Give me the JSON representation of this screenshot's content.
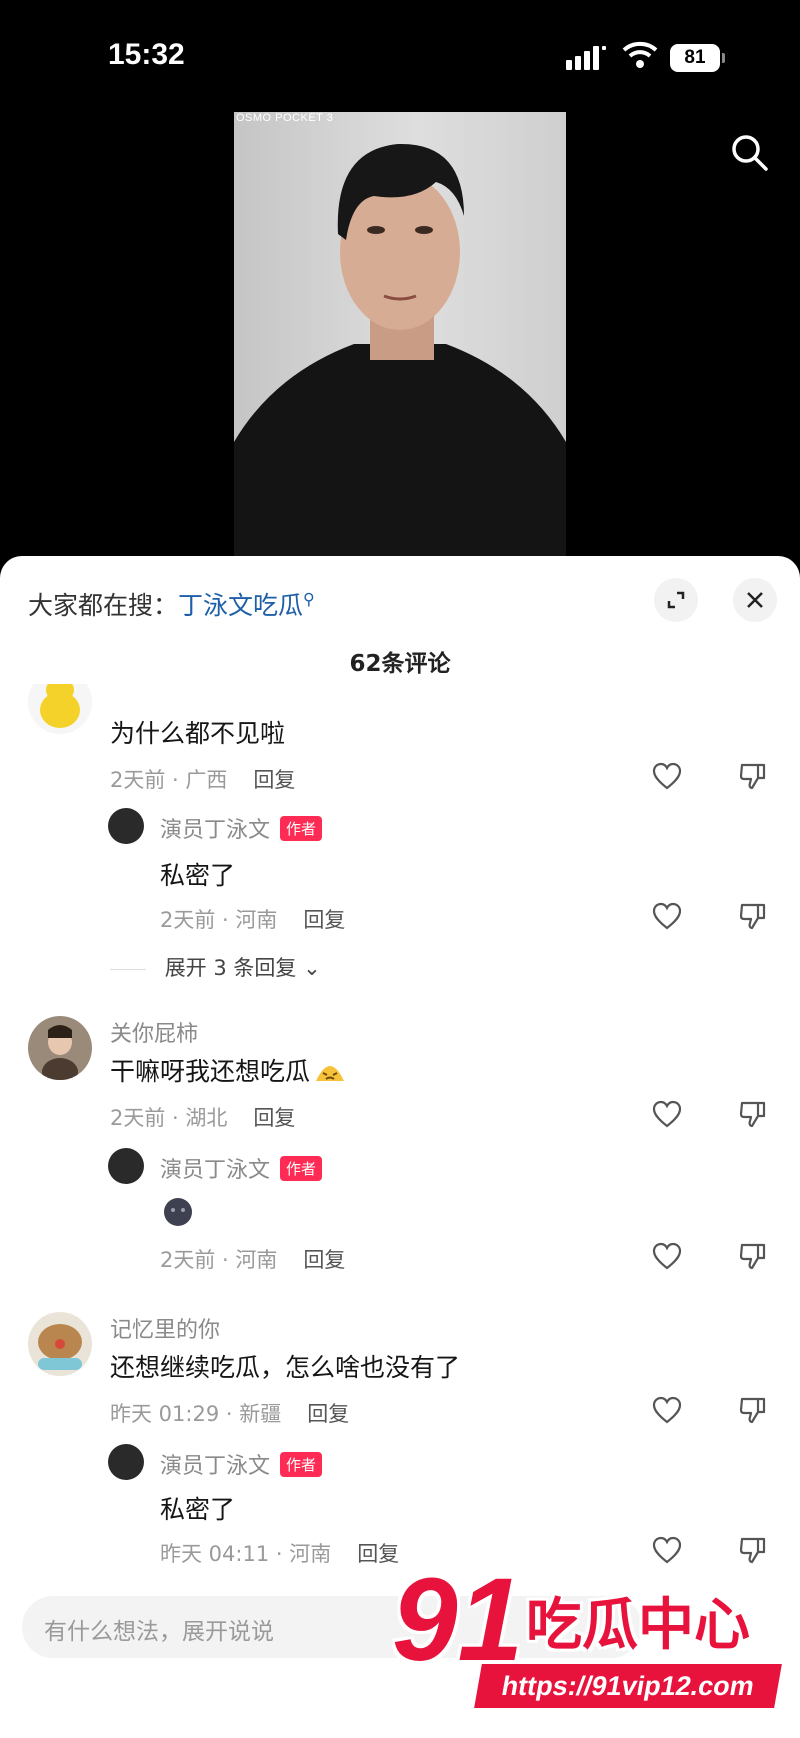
{
  "status_bar": {
    "time": "15:32",
    "battery": "81"
  },
  "video": {
    "camera_label": "OSMO POCKET 3"
  },
  "comments_panel": {
    "trending_prefix": "大家都在搜：",
    "trending_link": "丁泳文吃瓜",
    "count_label": "62条评论",
    "input_placeholder": "有什么想法，展开说说"
  },
  "comments": [
    {
      "text": "为什么都不见啦",
      "meta": "2天前 · 广西",
      "reply_label": "回复",
      "replies": [
        {
          "user": "演员丁泳文",
          "badge": "作者",
          "text": "私密了",
          "meta": "2天前 · 河南",
          "reply_label": "回复"
        }
      ],
      "expand_label": "展开 3 条回复"
    },
    {
      "user": "关你屁柿",
      "text": "干嘛呀我还想吃瓜",
      "meta": "2天前 · 湖北",
      "reply_label": "回复",
      "replies": [
        {
          "user": "演员丁泳文",
          "badge": "作者",
          "text": "",
          "meta": "2天前 · 河南",
          "reply_label": "回复"
        }
      ]
    },
    {
      "user": "记忆里的你",
      "text": "还想继续吃瓜，怎么啥也没有了",
      "meta": "昨天 01:29 · 新疆",
      "reply_label": "回复",
      "replies": [
        {
          "user": "演员丁泳文",
          "badge": "作者",
          "text": "私密了",
          "meta": "昨天 04:11 · 河南",
          "reply_label": "回复"
        }
      ]
    }
  ],
  "watermark": {
    "number": "91",
    "text": "吃瓜中心",
    "url": "https://91vip12.com"
  },
  "colors": {
    "accent_red": "#fe2c55",
    "link_blue": "#1e5fa8",
    "watermark_red": "#e8133c"
  }
}
